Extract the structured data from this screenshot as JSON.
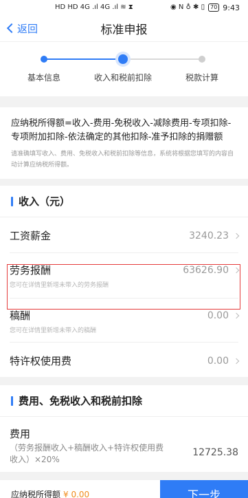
{
  "status_bar": {
    "left": "HD HD 4G .ıl 4G .ıl ≋ ⧗",
    "right": "◉ N ♁ ✱ ▯",
    "battery": "70",
    "time": "9:43"
  },
  "nav": {
    "back_label": "返回",
    "title": "标准申报"
  },
  "steps": [
    {
      "label": "基本信息",
      "state": "done"
    },
    {
      "label": "收入和税前扣除",
      "state": "current"
    },
    {
      "label": "税款计算",
      "state": "pending"
    }
  ],
  "formula": {
    "text": "应纳税所得额=收入-费用-免税收入-减除费用-专项扣除-专项附加扣除-依法确定的其他扣除-准予扣除的捐赠额",
    "note": "请准确填写收入、费用、免税收入和税前扣除等信息，系统将根据您填写的内容自动计算应纳税所得额。"
  },
  "income_section": {
    "title": "收入（元）",
    "rows": [
      {
        "label": "工资薪金",
        "value": "3240.23",
        "hint": ""
      },
      {
        "label": "劳务报酬",
        "value": "63626.90",
        "hint": "您可在详情里新增未带入的劳务报酬"
      },
      {
        "label": "稿酬",
        "value": "0.00",
        "hint": "您可在详情里新增未带入的稿酬"
      },
      {
        "label": "特许权使用费",
        "value": "0.00",
        "hint": ""
      }
    ]
  },
  "expense_section": {
    "title": "费用、免税收入和税前扣除",
    "fee_label": "费用",
    "fee_desc": "（劳务报酬收入+稿酬收入+特许权使用费收入）×20%",
    "fee_value": "12725.38"
  },
  "bottom": {
    "tax_label": "应纳税所得额",
    "tax_value": "¥ 0.00",
    "next_label": "下一步"
  },
  "colors": {
    "accent": "#2f7cf6",
    "highlight": "#e53b3b",
    "tax_value": "#f08c1c"
  }
}
